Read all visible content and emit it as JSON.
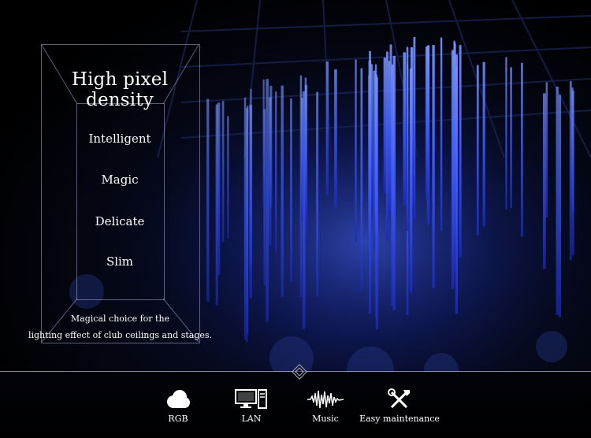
{
  "hero": {
    "title": "High pixel density",
    "features": [
      "Intelligent",
      "Magic",
      "Delicate",
      "Slim"
    ],
    "caption_line1": "Magical choice for the",
    "caption_line2": "lighting effect of club ceilings and stages."
  },
  "bottom_features": [
    {
      "label": "RGB",
      "icon": "cloud-icon"
    },
    {
      "label": "LAN",
      "icon": "computer-icon"
    },
    {
      "label": "Music",
      "icon": "soundwave-icon"
    },
    {
      "label": "Easy maintenance",
      "icon": "tools-icon"
    }
  ],
  "colors": {
    "accent": "#3b6bff",
    "background": "#000000",
    "text": "#ffffff"
  }
}
